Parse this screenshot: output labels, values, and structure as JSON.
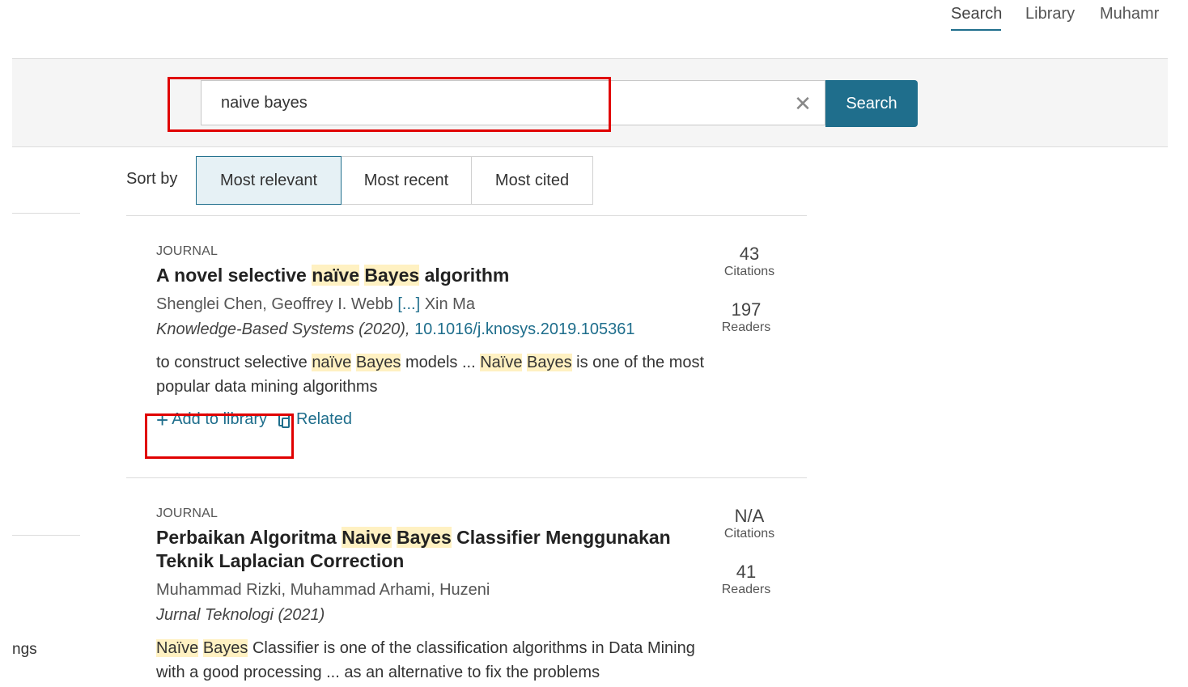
{
  "nav": {
    "search": "Search",
    "library": "Library",
    "user": "Muhamr"
  },
  "search": {
    "query": "naive bayes",
    "clear_glyph": "✕",
    "button": "Search"
  },
  "sidebar": {
    "partial_text": "ngs"
  },
  "sort": {
    "label": "Sort by",
    "options": [
      "Most relevant",
      "Most recent",
      "Most cited"
    ],
    "active": "Most relevant"
  },
  "results": [
    {
      "type": "JOURNAL",
      "title_parts": [
        "A novel selective ",
        "naïve",
        " ",
        "Bayes",
        " algorithm"
      ],
      "authors_prefix": "Shenglei Chen, Geoffrey I. Webb ",
      "authors_more": "[...]",
      "authors_suffix": " Xin Ma",
      "source": "Knowledge-Based Systems (2020), ",
      "doi": "10.1016/j.knosys.2019.105361",
      "snippet_parts": [
        "to construct selective ",
        "naïve",
        " ",
        "Bayes",
        " models ... ",
        "Naïve",
        " ",
        "Bayes",
        " is one of the most popular data mining algorithms"
      ],
      "citations": "43",
      "citations_label": "Citations",
      "readers": "197",
      "readers_label": "Readers",
      "actions": {
        "add_icon": "plus-icon",
        "add_label": "Add to library",
        "related_icon": "related-icon",
        "related_label": "Related"
      }
    },
    {
      "type": "JOURNAL",
      "title_parts": [
        "Perbaikan Algoritma ",
        "Naive",
        " ",
        "Bayes",
        " Classifier Menggunakan Teknik Laplacian Correction"
      ],
      "authors": "Muhammad Rizki, Muhammad Arhami, Huzeni",
      "source": "Jurnal Teknologi (2021)",
      "snippet_parts": [
        "Naïve",
        " ",
        "Bayes",
        " Classifier is one of the classification algorithms in Data Mining with a good processing ... as an alternative to fix the problems"
      ],
      "citations": "N/A",
      "citations_label": "Citations",
      "readers": "41",
      "readers_label": "Readers"
    }
  ],
  "colors": {
    "accent": "#1f6e8c",
    "highlight": "#fff1c2",
    "annotation_red": "#e00000"
  }
}
